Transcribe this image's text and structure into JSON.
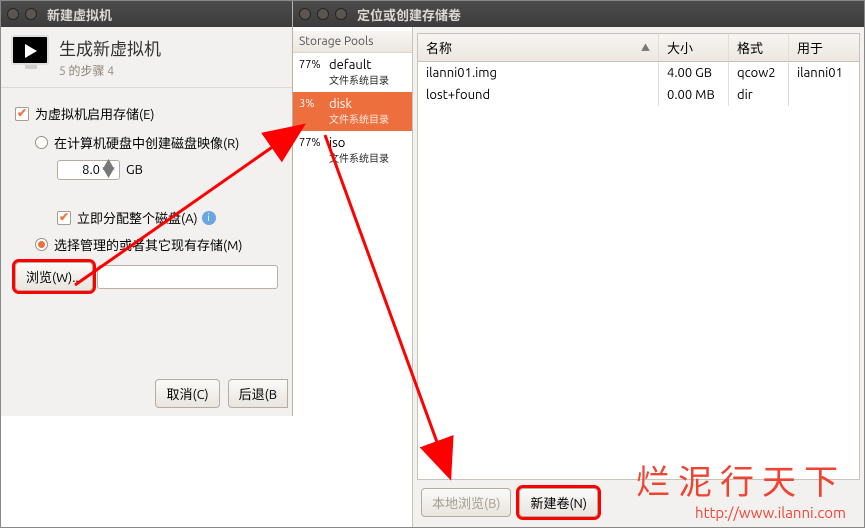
{
  "left_window": {
    "title": "新建虚拟机",
    "header": {
      "line1": "生成新虚拟机",
      "line2": "5 的步骤 4"
    },
    "enable_storage_label": "为虚拟机启用存储(E)",
    "create_disk_label": "在计算机硬盘中创建磁盘映像(R)",
    "size_value": "8.0",
    "size_unit": "GB",
    "alloc_label": "立即分配整个磁盘(A)",
    "managed_label": "选择管理的或者其它现有存储(M)",
    "browse_label": "浏览(W)...",
    "cancel_label": "取消(C)",
    "back_label": "后退(B"
  },
  "right_window": {
    "title": "定位或创建存储卷",
    "pools_header": "Storage Pools",
    "pools": [
      {
        "pct": "77%",
        "name": "default",
        "sub": "文件系统目录"
      },
      {
        "pct": "3%",
        "name": "disk",
        "sub": "文件系统目录"
      },
      {
        "pct": "77%",
        "name": "iso",
        "sub": "文件系统目录"
      }
    ],
    "columns": {
      "name": "名称",
      "size": "大小",
      "fmt": "格式",
      "use": "用于"
    },
    "rows": [
      {
        "name": "ilanni01.img",
        "size": "4.00 GB",
        "fmt": "qcow2",
        "use": "ilanni01"
      },
      {
        "name": "lost+found",
        "size": "0.00 MB",
        "fmt": "dir",
        "use": ""
      }
    ],
    "local_browse_label": "本地浏览(B)",
    "new_volume_label": "新建卷(N)"
  },
  "watermark": {
    "line1": "烂泥行天下",
    "line2": "http://www.ilanni.com"
  }
}
